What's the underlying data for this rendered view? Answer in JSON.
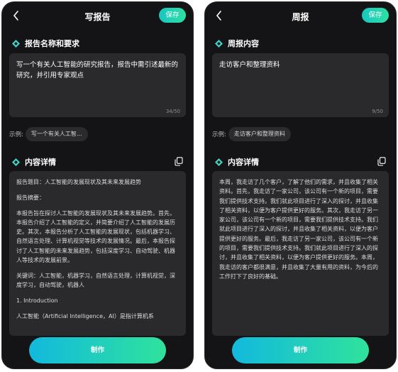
{
  "screens": [
    {
      "header": {
        "title": "写报告",
        "save_label": "保存"
      },
      "section1_title": "报告名称和要求",
      "input": {
        "value": "写一个有关人工智能的研究报告，报告中需引述最新的研究，并引用专家观点",
        "counter": "34/50"
      },
      "example": {
        "label": "示例:",
        "chip": "写一个有关人工智..."
      },
      "section2_title": "内容详情",
      "content": [
        "报告题目：人工智能的发展现状及其未来发展趋势",
        "报告摘要：",
        "本报告旨在探讨人工智能的发展现状及其未来发展趋势。首先，本报告介绍了人工智能的定义，并简要介绍了人工智能的发展历史。其次，本报告分析了人工智能的发展现状，包括机器学习、自然语言处理、计算机视觉等技术的发展情况。最后，本报告探讨了人工智能的未来发展趋势，包括深度学习、自动驾驶、机器人等技术的发展前景。",
        "关键词：人工智能，机器学习，自然语言处理，计算机视觉，深度学习，自动驾驶，机器人",
        "1. Introduction",
        "人工智能（Artificial Intelligence，AI）是指计算机系"
      ],
      "make_label": "制作"
    },
    {
      "header": {
        "title": "周报",
        "save_label": "保存"
      },
      "section1_title": "周报内容",
      "input": {
        "value": "走访客户和整理资料",
        "counter": "9/50"
      },
      "example": {
        "label": "示例:",
        "chip": "走访客户和整理资料"
      },
      "section2_title": "内容详情",
      "content": [
        "本周，我走访了几个客户，了解了他们的需求，并且收集了相关资料。首先，我走访了一家公司，该公司有一个新的项目，需要我们提供技术支持。我们就此项目进行了深入的探讨，并且收集了相关资料，以便为客户提供更好的服务。其次，我走访了另一家公司，该公司有一个新的项目，需要我们提供技术支持。我们就此项目进行了深入的探讨，并且收集了相关资料，以便为客户提供更好的服务。最后，我走访了另一家公司，该公司有一个新的项目，需要我们提供技术支持。我们就此项目进行了深入的探讨，并且收集了相关资料，以便为客户提供更好的服务。本周，我走访的客户都很满意，并且收集了大量有用的资料，为今后的工作打下了良好的基础。"
      ],
      "make_label": "制作"
    }
  ],
  "colors": {
    "phone_bg": "#141416",
    "card_bg": "#2a2a2d",
    "accent_start": "#12b9dd",
    "accent_end": "#2fe39c",
    "diamond": "#3fd6c8"
  },
  "icons": [
    "back-chevron-icon",
    "diamond-icon",
    "copy-icon"
  ]
}
